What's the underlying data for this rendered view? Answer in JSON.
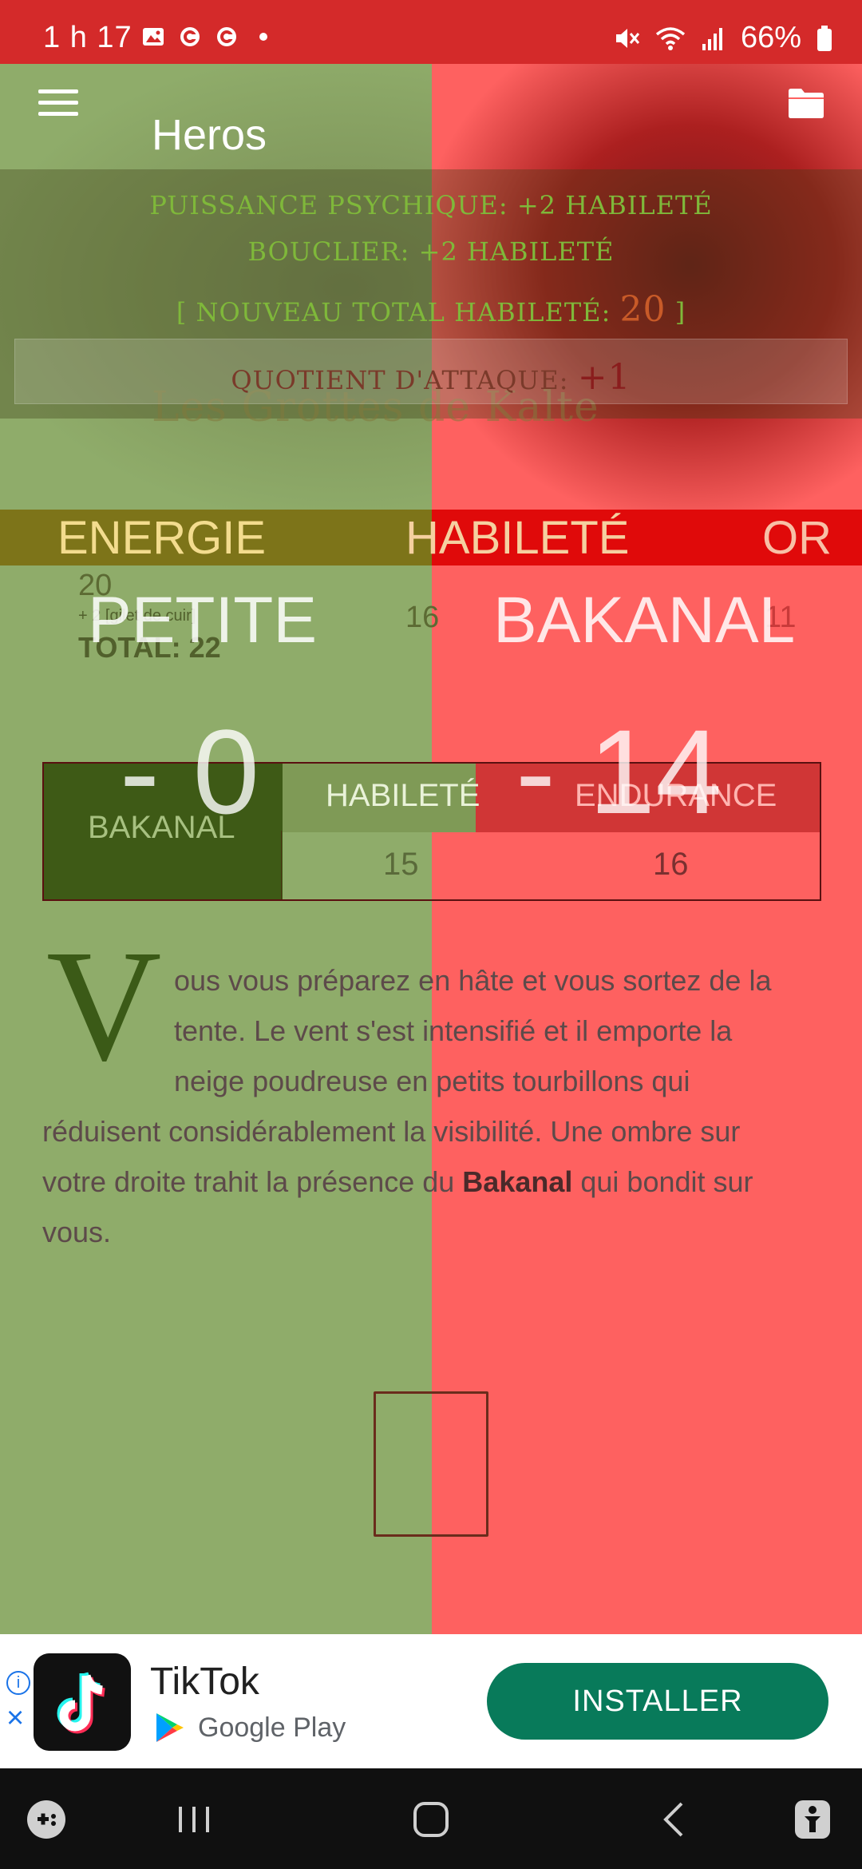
{
  "status_bar": {
    "time": "1 h 17",
    "battery": "66%"
  },
  "app_bar": {
    "title": "Heros"
  },
  "bonuses": {
    "line1": "PUISSANCE PSYCHIQUE: +2 HABILETÉ",
    "line2": "BOUCLIER: +2 HABILETÉ",
    "line3_prefix": "[ NOUVEAU TOTAL HABILETÉ: ",
    "line3_value": "20",
    "line3_suffix": " ]",
    "attack_label": "QUOTIENT D'ATTAQUE: ",
    "attack_value": "+1"
  },
  "book_title": "Les Grottes de Kalte",
  "stats": {
    "energie_label": "ENERGIE",
    "habilete_label": "HABILETÉ",
    "or_label": "OR",
    "energie_value": "20",
    "energie_note": "+ 2 [gilet de cuir]",
    "energie_total": "TOTAL: 22",
    "habilete_value": "16",
    "or_value": "11"
  },
  "combat": {
    "left_name": "PETITE",
    "right_name": "BAKANAL",
    "left_damage": "- 0",
    "right_damage": "- 14"
  },
  "enemy": {
    "name": "BAKANAL",
    "col_habilete": "HABILETÉ",
    "col_endurance": "ENDURANCE",
    "habilete": "15",
    "endurance": "16"
  },
  "narrative": {
    "dropcap": "V",
    "line1": "ous vous préparez en hâte et vous sortez de la",
    "line2": "tente. Le vent s'est intensifié et il emporte la",
    "line3": "neige poudreuse en petits tourbillons qui",
    "line4": "réduisent considérablement la visibilité. Une ombre sur",
    "line5_pre": "votre droite trahit la présence du ",
    "line5_bold": "Bakanal",
    "line5_post": " qui bondit sur",
    "line6": "vous."
  },
  "ad": {
    "app_name": "TikTok",
    "store_name": "Google Play",
    "install_label": "INSTALLER",
    "info_glyph": "i",
    "close_glyph": "×"
  },
  "colors": {
    "left_panel": "#8fac6a",
    "right_panel": "#fe6160",
    "status_bar": "#d42a2a",
    "install_button": "#087a5a"
  }
}
